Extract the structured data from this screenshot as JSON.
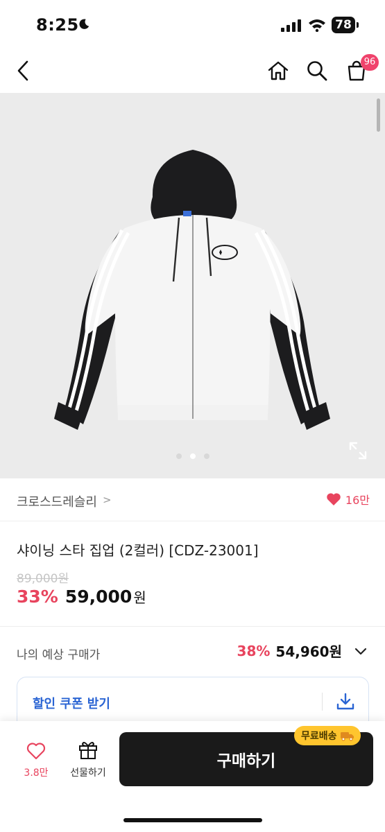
{
  "status_bar": {
    "time": "8:25",
    "battery": "78"
  },
  "nav": {
    "cart_count": "96"
  },
  "colors": {
    "accent": "#e8445e",
    "coupon_blue": "#2a64d3",
    "free_ship_yellow": "#ffc52e",
    "buy_button": "#1a1a1a"
  },
  "gallery": {
    "image_count": 3,
    "active_index": 1
  },
  "brand": {
    "name": "크로스드레슬리",
    "chevron": ">",
    "likes": "16만"
  },
  "product": {
    "title": "샤이닝 스타 집업 (2컬러) [CDZ-23001]",
    "original_price": "89,000원",
    "discount": "33%",
    "price": "59,000",
    "price_unit": "원"
  },
  "expected_price": {
    "label": "나의 예상 구매가",
    "rate": "38%",
    "price": "54,960원"
  },
  "coupon": {
    "label": "할인 쿠폰 받기"
  },
  "bottom_bar": {
    "wish_count": "3.8만",
    "gift_label": "선물하기",
    "buy_label": "구매하기",
    "free_shipping": "무료배송"
  }
}
